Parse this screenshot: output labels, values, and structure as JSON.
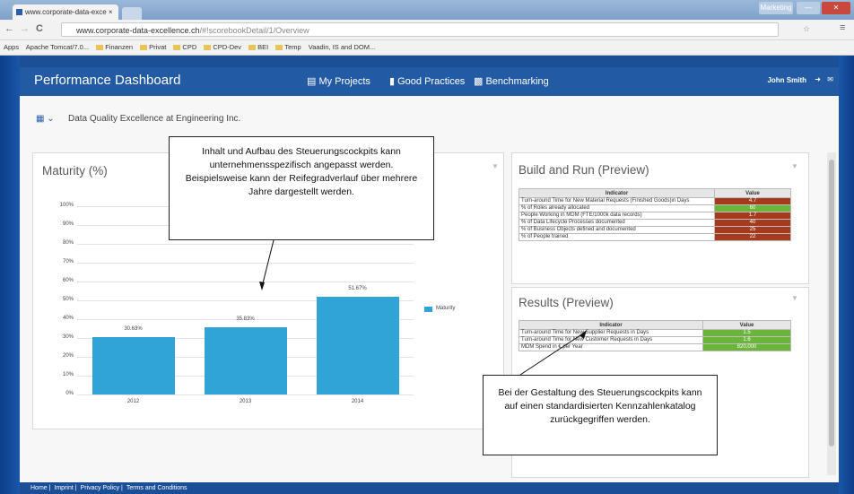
{
  "browser": {
    "tab_title": "www.corporate-data-exce ×",
    "window_controls": [
      "Marketing",
      "—",
      "✕"
    ],
    "url_host": "www.corporate-data-excellence.ch",
    "url_path": "/#!scorebookDetail/1/Overview",
    "bookmarks": [
      "Apps",
      "Apache Tomcat/7.0...",
      "Finanzen",
      "Privat",
      "CPD",
      "CPD-Dev",
      "BEI",
      "Temp",
      "Vaadin, IS and DOM..."
    ]
  },
  "header": {
    "title": "Performance Dashboard",
    "nav": [
      "My Projects",
      "Good Practices",
      "Benchmarking"
    ],
    "user": "John Smith"
  },
  "breadcrumb": "Data Quality Excellence at Engineering Inc.",
  "maturity": {
    "title": "Maturity (%)",
    "legend": "Maturity"
  },
  "chart_data": {
    "type": "bar",
    "title": "Maturity (%)",
    "categories": [
      "2012",
      "2013",
      "2014"
    ],
    "series": [
      {
        "name": "Maturity",
        "values": [
          30.63,
          35.83,
          51.67
        ]
      }
    ],
    "value_labels": [
      "30.63%",
      "35.83%",
      "51.67%"
    ],
    "yticks": [
      "100%",
      "90%",
      "80%",
      "70%",
      "60%",
      "50%",
      "40%",
      "30%",
      "20%",
      "10%",
      "0%"
    ],
    "ylim": [
      0,
      100
    ],
    "grid": true,
    "legend_position": "right",
    "color": "#30a4d6"
  },
  "build_run": {
    "title": "Build and Run (Preview)",
    "headers": [
      "Indicator",
      "Value"
    ],
    "rows": [
      {
        "indicator": "Turn-around Time for New Material Requests (Finished Goods)in Days",
        "value": "4.7",
        "color": "#a63a1e"
      },
      {
        "indicator": "% of Roles already allocated",
        "value": "60",
        "color": "#6bb53a"
      },
      {
        "indicator": "People Working in MDM (FTE/1000k data records)",
        "value": "1.7",
        "color": "#a63a1e"
      },
      {
        "indicator": "% of Data Lifecycle Processes documented",
        "value": "40",
        "color": "#a63a1e"
      },
      {
        "indicator": "% of Business Objects defined and documented",
        "value": "25",
        "color": "#a63a1e"
      },
      {
        "indicator": "% of People trained",
        "value": "22",
        "color": "#a63a1e"
      }
    ]
  },
  "results": {
    "title": "Results (Preview)",
    "headers": [
      "Indicator",
      "Value"
    ],
    "rows": [
      {
        "indicator": "Turn-around Time for New Supplier Requests in Days",
        "value": "1.5",
        "color": "#6bb53a"
      },
      {
        "indicator": "Turn-around Time for New Customer Requests in Days",
        "value": "1.6",
        "color": "#6bb53a"
      },
      {
        "indicator": "MDM Spend in € per Year",
        "value": "820,000",
        "color": "#6bb53a"
      }
    ]
  },
  "callout_top": "Inhalt und Aufbau des Steuerungscockpits kann unternehmensspezifisch angepasst werden. Beispielsweise kann der Reifegradverlauf über mehrere Jahre dargestellt werden.",
  "callout_bottom": "Bei der Gestaltung des Steuerungscockpits kann auf einen standardisierten Kennzahlenkatalog zurückgegriffen werden.",
  "footer": [
    "Home",
    "Imprint",
    "Privacy Policy",
    "Terms and Conditions"
  ]
}
